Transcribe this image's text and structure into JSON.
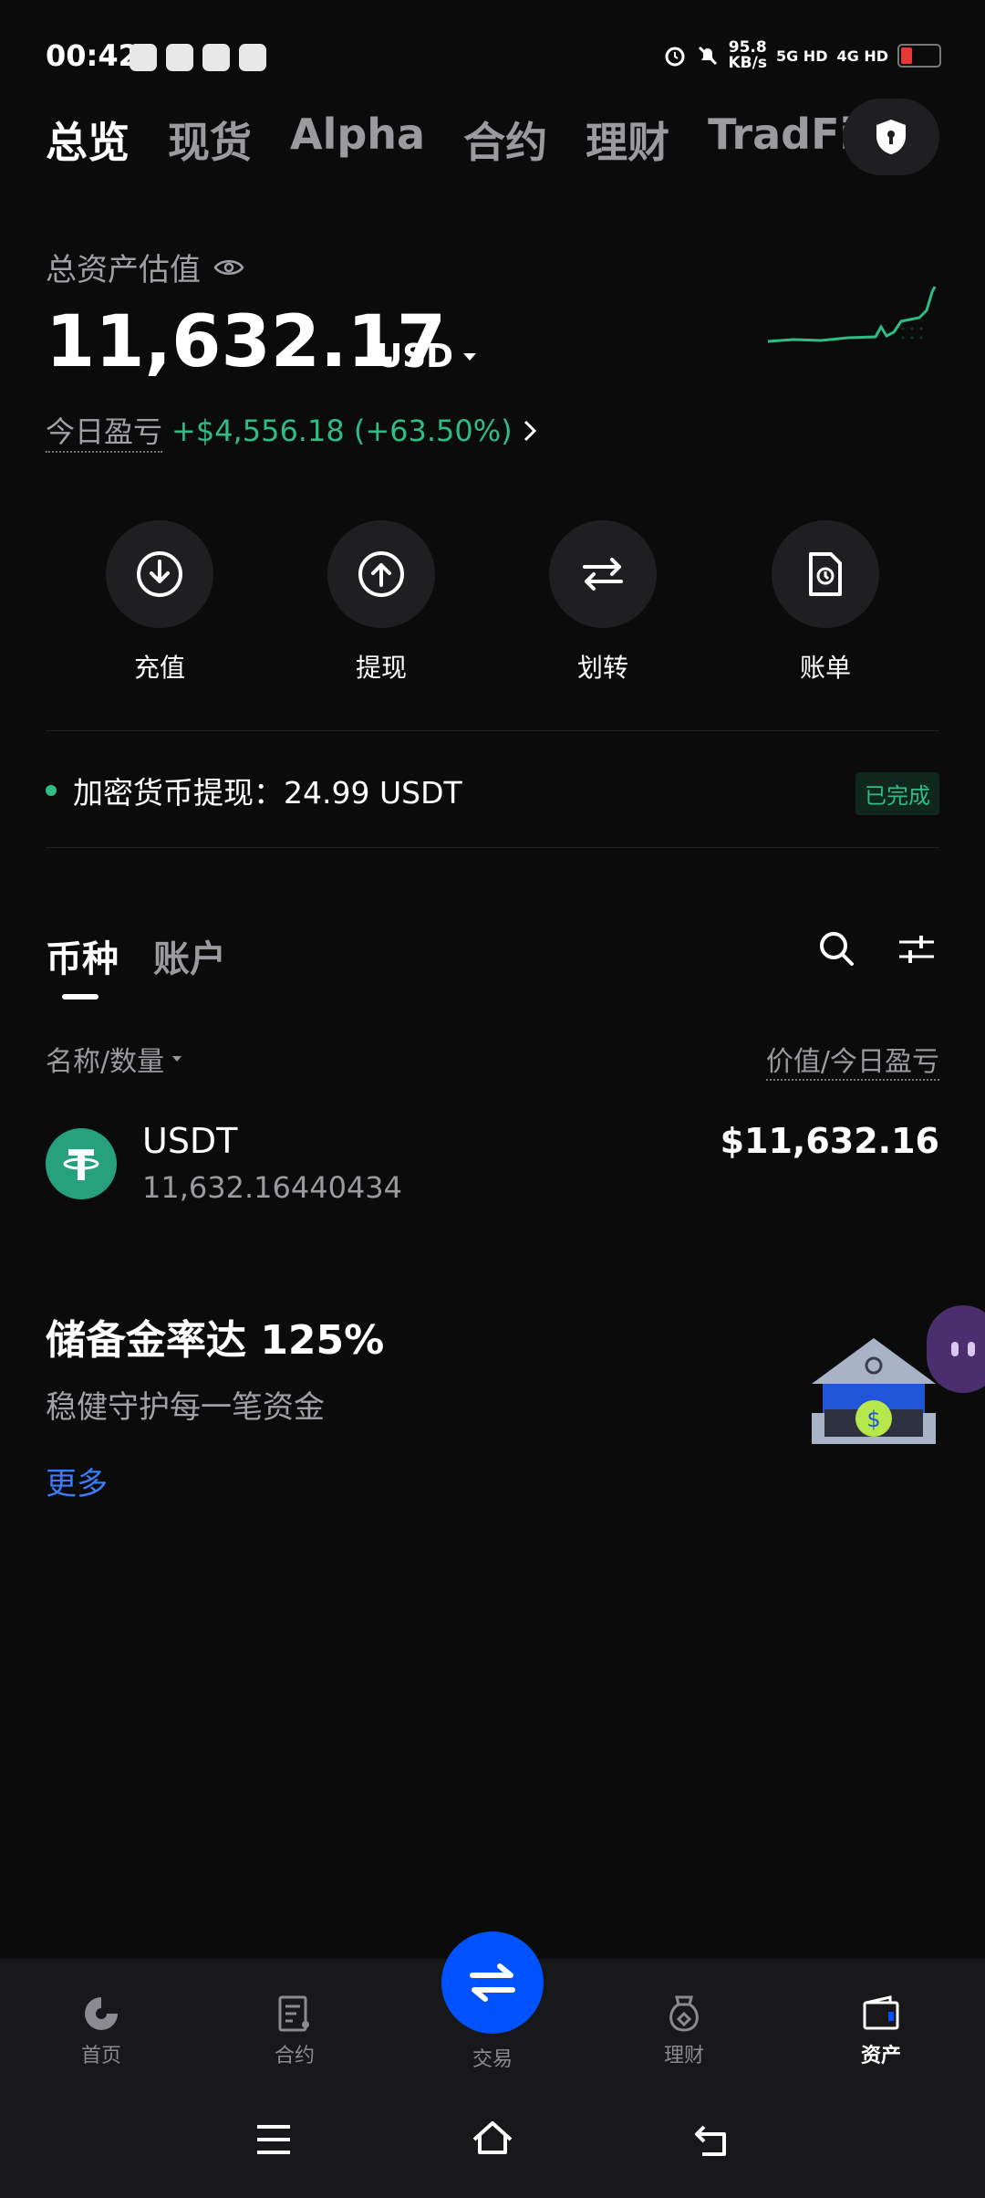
{
  "status_bar": {
    "time": "00:42",
    "net_speed": "95.8",
    "net_unit": "KB/s",
    "net1": "5G HD",
    "net2": "4G HD",
    "battery": "low"
  },
  "top_tabs": [
    {
      "label": "总览",
      "active": true
    },
    {
      "label": "现货"
    },
    {
      "label": "Alpha"
    },
    {
      "label": "合约"
    },
    {
      "label": "理财"
    },
    {
      "label": "TradFi"
    }
  ],
  "balance": {
    "label": "总资产估值",
    "value": "11,632.17",
    "currency": "USD",
    "pnl_label": "今日盈亏",
    "pnl_value": "+$4,556.18 (+63.50%)"
  },
  "actions": [
    {
      "label": "充值",
      "icon": "deposit-icon"
    },
    {
      "label": "提现",
      "icon": "withdraw-icon"
    },
    {
      "label": "划转",
      "icon": "transfer-icon"
    },
    {
      "label": "账单",
      "icon": "bill-icon"
    }
  ],
  "notice": {
    "text": "加密货币提现：24.99 USDT",
    "status": "已完成"
  },
  "asset_tabs": [
    {
      "label": "币种",
      "active": true
    },
    {
      "label": "账户"
    }
  ],
  "list_header": {
    "left": "名称/数量",
    "right": "价值/今日盈亏"
  },
  "assets": [
    {
      "symbol": "USDT",
      "amount": "11,632.16440434",
      "value": "$11,632.16"
    }
  ],
  "promo": {
    "title": "储备金率达 125%",
    "subtitle": "稳健守护每一笔资金",
    "more": "更多"
  },
  "bottom_nav": [
    {
      "label": "首页",
      "icon": "home-icon"
    },
    {
      "label": "合约",
      "icon": "futures-icon"
    },
    {
      "label": "交易",
      "icon": "trade-icon"
    },
    {
      "label": "理财",
      "icon": "earn-icon"
    },
    {
      "label": "资产",
      "icon": "wallet-icon",
      "active": true
    }
  ],
  "colors": {
    "background": "#0b0b0c",
    "positive": "#2ebd85",
    "accent": "#0052ff",
    "link": "#3d7bf7"
  }
}
